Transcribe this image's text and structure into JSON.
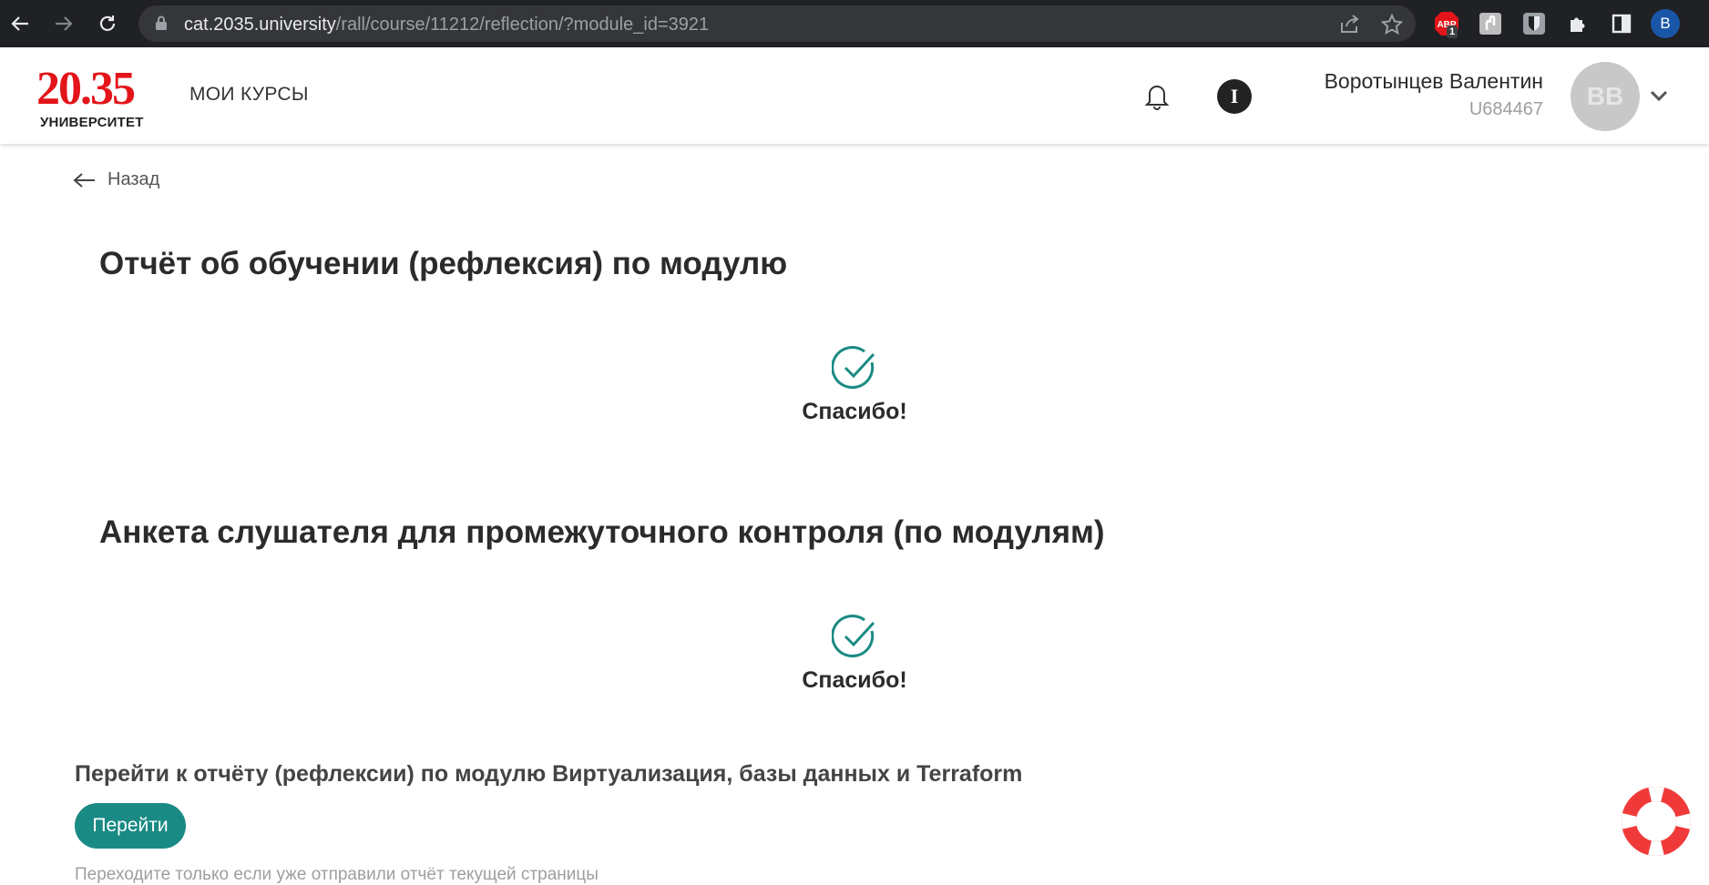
{
  "browser": {
    "url_host": "cat.2035.university",
    "url_path": "/rall/course/11212/reflection/?module_id=3921",
    "abp_badge": "1",
    "profile_letter": "B"
  },
  "header": {
    "logo_number": "20.35",
    "logo_subtitle": "УНИВЕРСИТЕТ",
    "nav_my_courses": "МОИ КУРСЫ",
    "info_letter": "I",
    "user_name": "Воротынцев Валентин",
    "user_id": "U684467",
    "avatar_initials": "ВВ"
  },
  "content": {
    "back_label": "Назад",
    "section1_title": "Отчёт об обучении (рефлексия) по модулю",
    "section1_status": "Спасибо!",
    "section2_title": "Анкета слушателя для промежуточного контроля (по модулям)",
    "section2_status": "Спасибо!",
    "goto_text": "Перейти к отчёту (рефлексии) по модулю Виртуализация, базы данных и Terraform",
    "goto_button": "Перейти",
    "hint": "Переходите только если уже отправили отчёт текущей страницы"
  },
  "colors": {
    "accent": "#1a8a84",
    "logo_red": "#e3151a",
    "browser_dark": "#202124"
  },
  "icons": [
    "back-arrow-icon",
    "forward-arrow-icon",
    "reload-icon",
    "lock-icon",
    "share-icon",
    "star-icon",
    "adblock-icon",
    "extension-icon",
    "bitwarden-icon",
    "puzzle-icon",
    "side-panel-icon",
    "bell-icon",
    "info-icon",
    "chevron-down-icon",
    "arrow-left-icon",
    "check-circle-icon",
    "lifebuoy-icon"
  ]
}
